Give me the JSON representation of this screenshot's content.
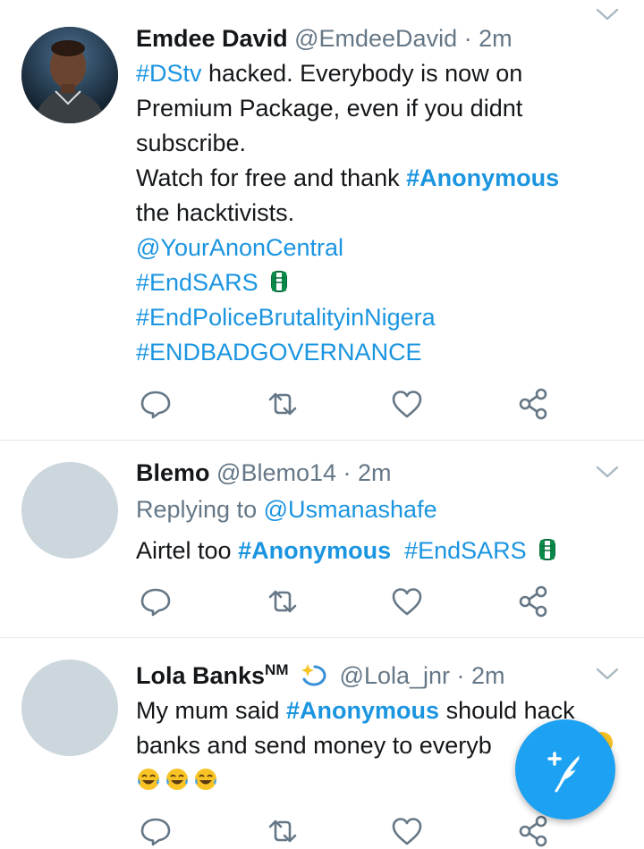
{
  "colors": {
    "link": "#1b95e0",
    "meta": "#657786",
    "fab": "#1da1f2",
    "icon": "#657786"
  },
  "tweets": [
    {
      "name": "Emdee David",
      "handle": "@EmdeeDavid",
      "time": "· 2m",
      "lines": {
        "l1_tag": "#DStv",
        "l1_text": " hacked. Everybody is now on",
        "l2": "Premium Package, even if you didnt",
        "l3": "subscribe.",
        "l4_text": "Watch for free and thank ",
        "l4_tag": "#Anonymous",
        "l5": "the hacktivists.",
        "l6": "@YourAnonCentral",
        "l7": "#EndSARS",
        "l8": "#EndPoliceBrutalityinNigera",
        "l9": "#ENDBADGOVERNANCE"
      }
    },
    {
      "name": "Blemo",
      "handle": "@Blemo14",
      "time": "· 2m",
      "replying_label": "Replying to ",
      "replying_to": "@Usmanashafe",
      "text": "Airtel too ",
      "tag1": "#Anonymous",
      "tag2": "#EndSARS"
    },
    {
      "name": "Lola Banks",
      "name_sup": "NM",
      "handle": "@Lola_jnr",
      "time": "· 2m",
      "text1": "My mum said ",
      "tag": "#Anonymous",
      "text1b": " should hack",
      "text2": "banks and send money to everyb"
    }
  ],
  "icons": {
    "reply": "reply-icon",
    "retweet": "retweet-icon",
    "like": "heart-icon",
    "share": "share-icon",
    "chevron": "chevron-down-icon",
    "compose": "compose-tweet-icon"
  }
}
